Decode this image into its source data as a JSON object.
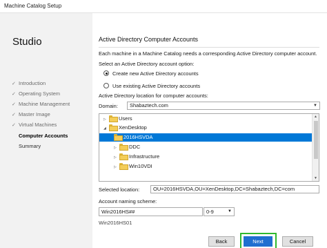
{
  "window": {
    "title": "Machine Catalog Setup"
  },
  "sidebar": {
    "app_name": "Studio",
    "steps": [
      {
        "label": "Introduction",
        "state": "done"
      },
      {
        "label": "Operating System",
        "state": "done"
      },
      {
        "label": "Machine Management",
        "state": "done"
      },
      {
        "label": "Master Image",
        "state": "done"
      },
      {
        "label": "Virtual Machines",
        "state": "done"
      },
      {
        "label": "Computer Accounts",
        "state": "active"
      },
      {
        "label": "Summary",
        "state": "future"
      }
    ]
  },
  "main": {
    "heading": "Active Directory Computer Accounts",
    "description": "Each machine in a Machine Catalog needs a corresponding Active Directory computer account.",
    "account_option_label": "Select an Active Directory account option:",
    "options": [
      {
        "label": "Create new Active Directory accounts",
        "checked": true
      },
      {
        "label": "Use existing Active Directory accounts",
        "checked": false
      }
    ],
    "location_label": "Active Directory location for computer accounts:",
    "domain_label": "Domain:",
    "domain_value": "Shabaztech.com",
    "tree": [
      {
        "label": "Users",
        "expander": "▷"
      },
      {
        "label": "XenDesktop",
        "expander": "◢"
      },
      {
        "label": "2016HSVDA",
        "expander": "",
        "selected": true
      },
      {
        "label": "DDC",
        "expander": "▷"
      },
      {
        "label": "Infrastructure",
        "expander": "▷"
      },
      {
        "label": "Win10VDI",
        "expander": "▷"
      }
    ],
    "selected_location_label": "Selected location:",
    "selected_location_value": "OU=2016HSVDA,OU=XenDesktop,DC=Shabaztech,DC=com",
    "naming_label": "Account naming scheme:",
    "naming_value": "Win2016HS##",
    "naming_type": "0-9",
    "naming_example": "Win2016HS01"
  },
  "buttons": {
    "back": "Back",
    "next": "Next",
    "cancel": "Cancel"
  },
  "colors": {
    "accent": "#0078d7",
    "next_button": "#1f6fd0",
    "highlight": "#2eb82e"
  }
}
